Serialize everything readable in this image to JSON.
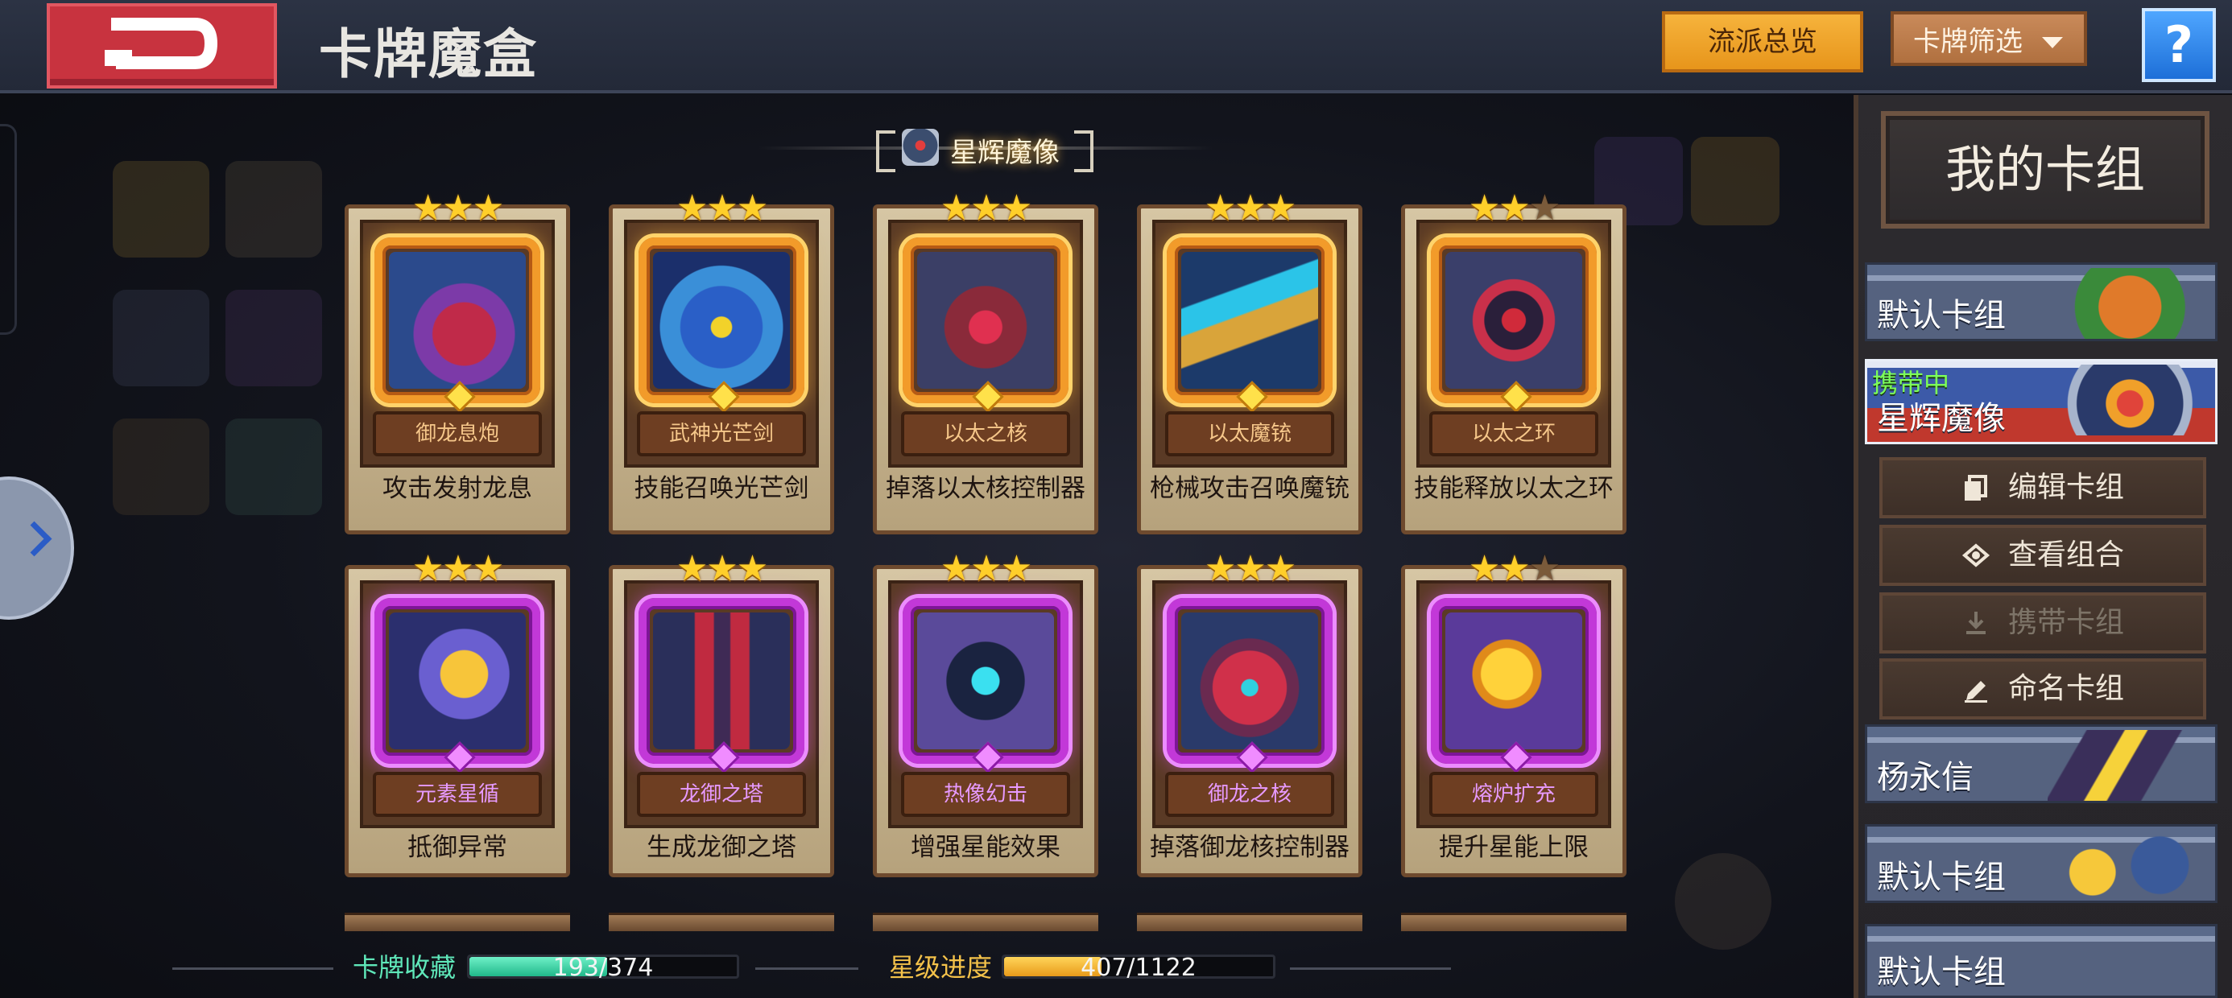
{
  "header": {
    "title": "卡牌魔盒",
    "overview_btn": "流派总览",
    "filter_btn": "卡牌筛选",
    "help_btn": "?"
  },
  "section": {
    "title": "星辉魔像"
  },
  "cards": [
    {
      "name": "御龙息炮",
      "effect": "攻击发射龙息",
      "stars": 3,
      "rarity": "gold"
    },
    {
      "name": "武神光芒剑",
      "effect": "技能召唤光芒剑",
      "stars": 3,
      "rarity": "gold"
    },
    {
      "name": "以太之核",
      "effect": "掉落以太核控制器",
      "stars": 3,
      "rarity": "gold"
    },
    {
      "name": "以太魔铳",
      "effect": "枪械攻击召唤魔铳",
      "stars": 3,
      "rarity": "gold"
    },
    {
      "name": "以太之环",
      "effect": "技能释放以太之环",
      "stars": 2,
      "rarity": "gold"
    },
    {
      "name": "元素星循",
      "effect": "抵御异常",
      "stars": 3,
      "rarity": "purple"
    },
    {
      "name": "龙御之塔",
      "effect": "生成龙御之塔",
      "stars": 3,
      "rarity": "purple"
    },
    {
      "name": "热像幻击",
      "effect": "增强星能效果",
      "stars": 3,
      "rarity": "purple"
    },
    {
      "name": "御龙之核",
      "effect": "掉落御龙核控制器",
      "stars": 3,
      "rarity": "purple"
    },
    {
      "name": "熔炉扩充",
      "effect": "提升星能上限",
      "stars": 2,
      "rarity": "purple"
    }
  ],
  "progress": {
    "collection_label": "卡牌收藏",
    "collection_text": "193/374",
    "collection_value": 193,
    "collection_total": 374,
    "star_label": "星级进度",
    "star_text": "407/1122",
    "star_value": 407,
    "star_total": 1122
  },
  "deck_panel": {
    "title": "我的卡组",
    "carry_badge": "携带中",
    "decks": [
      {
        "name": "默认卡组"
      },
      {
        "name": "星辉魔像"
      },
      {
        "name": "杨永信"
      },
      {
        "name": "默认卡组"
      },
      {
        "name": "默认卡组"
      }
    ],
    "actions": [
      "编辑卡组",
      "查看组合",
      "携带卡组",
      "命名卡组"
    ]
  },
  "colors": {
    "accent_orange": "#f6b33c",
    "gold_frame": "#f29b2a",
    "purple_frame": "#c238d8",
    "collection_fill": "#20b88a",
    "star_fill": "#e89a1a",
    "carry_badge": "#7dff5a"
  }
}
